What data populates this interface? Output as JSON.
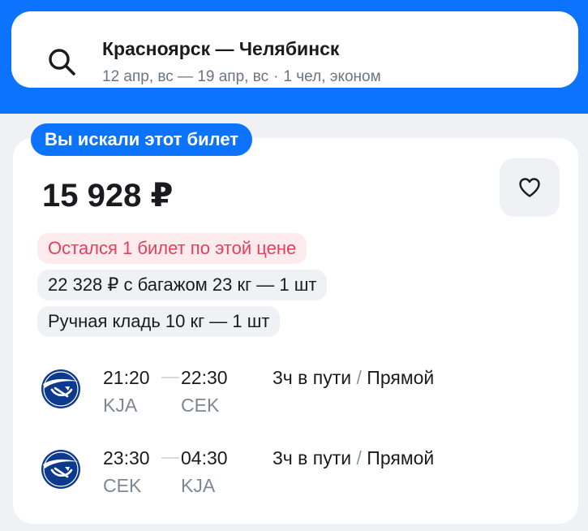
{
  "search": {
    "route": "Красноярск — Челябинск",
    "dates": "12 апр, вс — 19 апр, вс",
    "separator": "·",
    "passengers": "1 чел, эконом"
  },
  "ticket": {
    "badge": "Вы искали этот билет",
    "price": "15 928 ₽",
    "chips": {
      "warning": "Остался 1 билет по этой цене",
      "baggage": "22 328 ₽ с багажом 23 кг — 1 шт",
      "hand_luggage": "Ручная кладь 10 кг — 1 шт"
    },
    "segments": [
      {
        "airline_icon": "aeroflot-logo-icon",
        "depart_time": "21:20",
        "arrive_time": "22:30",
        "depart_airport": "KJA",
        "arrive_airport": "CEK",
        "duration": "3ч в пути",
        "slash": "/",
        "type": "Прямой"
      },
      {
        "airline_icon": "aeroflot-logo-icon",
        "depart_time": "23:30",
        "arrive_time": "04:30",
        "depart_airport": "CEK",
        "arrive_airport": "KJA",
        "duration": "3ч в пути",
        "slash": "/",
        "type": "Прямой"
      }
    ]
  },
  "colors": {
    "brand_blue": "#0c73fe",
    "warning_red": "#e0425b",
    "warning_bg": "#feebed",
    "airline_blue": "#0d3a8c"
  }
}
